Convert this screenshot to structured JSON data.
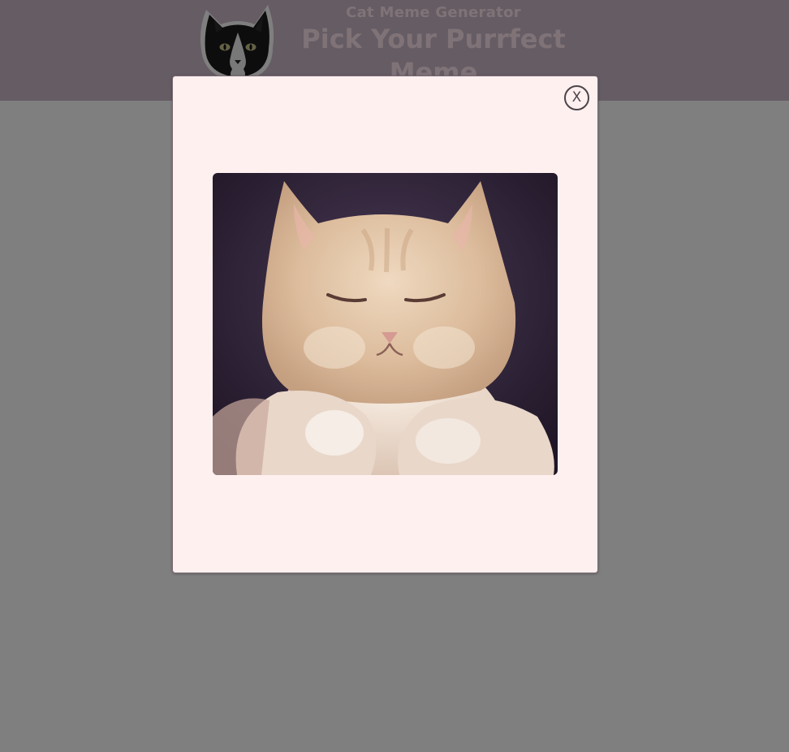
{
  "header": {
    "subtitle": "Cat Meme Generator",
    "title": "Pick Your Purrfect Meme",
    "logo_icon": "tuxedo-cat-logo-icon"
  },
  "modal": {
    "close_label": "X",
    "image_icon": "sleepy-cat-gif"
  },
  "colors": {
    "header_bg": "#cab8c8",
    "header_text": "#ffe6ee",
    "overlay": "rgba(0,0,0,0.5)",
    "modal_bg": "#fff0f0",
    "close_border": "#4d4448"
  }
}
